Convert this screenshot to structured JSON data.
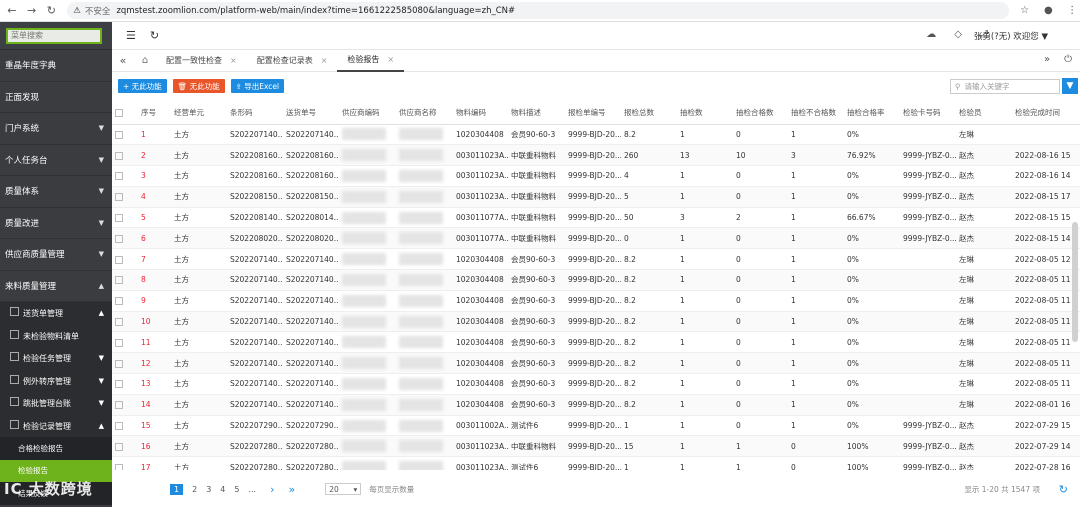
{
  "browser": {
    "back_icon": "arrow-left",
    "forward_icon": "arrow-right",
    "reload_icon": "reload",
    "insecure_label": "不安全",
    "url": "zqmstest.zoomlion.com/platform-web/main/index?time=1661222585080&language=zh_CN#"
  },
  "sidebar": {
    "search_placeholder": "菜单搜索",
    "items": [
      {
        "label": "重晶年度字典",
        "arrow": ""
      },
      {
        "label": "正面发现",
        "arrow": ""
      },
      {
        "label": "门户系统",
        "arrow": "▼"
      },
      {
        "label": "个人任务台",
        "arrow": "▼"
      },
      {
        "label": "质量体系",
        "arrow": "▼"
      },
      {
        "label": "质量改进",
        "arrow": "▼"
      },
      {
        "label": "供应商质量管理",
        "arrow": "▼"
      },
      {
        "label": "来料质量管理",
        "arrow": "▲"
      }
    ],
    "subitems": [
      {
        "label": "送货单管理",
        "arrow": "▲"
      },
      {
        "label": "未检验物料清单",
        "arrow": ""
      },
      {
        "label": "检验任务管理",
        "arrow": "▼"
      },
      {
        "label": "例外转序管理",
        "arrow": "▼"
      },
      {
        "label": "跳批管理台账",
        "arrow": "▼"
      },
      {
        "label": "检验记录管理",
        "arrow": "▲"
      }
    ],
    "leaf_items": [
      "合格检验报告",
      "检验报告",
      "结果反馈"
    ],
    "watermark": "IC 大数跨境"
  },
  "topbar": {
    "user": "张勇(?无) 欢迎您 ▼"
  },
  "tabs": [
    {
      "label": "配置一致性检查"
    },
    {
      "label": "配置检查记录表"
    },
    {
      "label": "检验报告"
    }
  ],
  "toolbar": {
    "btn1": "+ 无此功能",
    "btn2": "无此功能",
    "btn3": "导出Excel",
    "search_placeholder": "请输入关键字"
  },
  "table": {
    "columns": [
      "序号",
      "经营单元",
      "条形码",
      "送货单号",
      "供应商编码",
      "供应商名称",
      "物料编码",
      "物料描述",
      "报检单编号",
      "报检总数",
      "抽检数",
      "抽检合格数",
      "抽检不合格数",
      "抽检合格率",
      "检验卡号码",
      "检验员",
      "检验完成时间"
    ],
    "rows": [
      [
        "1",
        "土方",
        "S202207140...",
        "S202207140...",
        "",
        "",
        "1020304408",
        "会员90-60-3",
        "9999-BJD-20...",
        "8.2",
        "1",
        "0",
        "1",
        "0%",
        "",
        "左琳",
        ""
      ],
      [
        "2",
        "土方",
        "S202208160...",
        "S202208160...",
        "",
        "",
        "003011023A...",
        "中联重科物料",
        "9999-BJD-20...",
        "260",
        "13",
        "10",
        "3",
        "76.92%",
        "9999-JYBZ-0...",
        "赵杰",
        "2022-08-16 15"
      ],
      [
        "3",
        "土方",
        "S202208160...",
        "S202208160...",
        "",
        "",
        "003011023A...",
        "中联重科物料",
        "9999-BJD-20...",
        "4",
        "1",
        "0",
        "1",
        "0%",
        "9999-JYBZ-0...",
        "赵杰",
        "2022-08-16 14"
      ],
      [
        "4",
        "土方",
        "S202208150...",
        "S202208150...",
        "",
        "",
        "003011023A...",
        "中联重科物料",
        "9999-BJD-20...",
        "5",
        "1",
        "0",
        "1",
        "0%",
        "9999-JYBZ-0...",
        "赵杰",
        "2022-08-15 17"
      ],
      [
        "5",
        "土方",
        "S202208140...",
        "S202208014...",
        "",
        "",
        "003011077A...",
        "中联重科物料",
        "9999-BJD-20...",
        "50",
        "3",
        "2",
        "1",
        "66.67%",
        "9999-JYBZ-0...",
        "赵杰",
        "2022-08-15 15"
      ],
      [
        "6",
        "土方",
        "S202208020...",
        "S202208020...",
        "",
        "",
        "003011077A...",
        "中联重科物料",
        "9999-BJD-20...",
        "0",
        "1",
        "0",
        "1",
        "0%",
        "9999-JYBZ-0...",
        "赵杰",
        "2022-08-15 14"
      ],
      [
        "7",
        "土方",
        "S202207140...",
        "S202207140...",
        "",
        "",
        "1020304408",
        "会员90-60-3",
        "9999-BJD-20...",
        "8.2",
        "1",
        "0",
        "1",
        "0%",
        "",
        "左琳",
        "2022-08-05 12"
      ],
      [
        "8",
        "土方",
        "S202207140...",
        "S202207140...",
        "",
        "",
        "1020304408",
        "会员90-60-3",
        "9999-BJD-20...",
        "8.2",
        "1",
        "0",
        "1",
        "0%",
        "",
        "左琳",
        "2022-08-05 11"
      ],
      [
        "9",
        "土方",
        "S202207140...",
        "S202207140...",
        "",
        "",
        "1020304408",
        "会员90-60-3",
        "9999-BJD-20...",
        "8.2",
        "1",
        "0",
        "1",
        "0%",
        "",
        "左琳",
        "2022-08-05 11"
      ],
      [
        "10",
        "土方",
        "S202207140...",
        "S202207140...",
        "",
        "",
        "1020304408",
        "会员90-60-3",
        "9999-BJD-20...",
        "8.2",
        "1",
        "0",
        "1",
        "0%",
        "",
        "左琳",
        "2022-08-05 11"
      ],
      [
        "11",
        "土方",
        "S202207140...",
        "S202207140...",
        "",
        "",
        "1020304408",
        "会员90-60-3",
        "9999-BJD-20...",
        "8.2",
        "1",
        "0",
        "1",
        "0%",
        "",
        "左琳",
        "2022-08-05 11"
      ],
      [
        "12",
        "土方",
        "S202207140...",
        "S202207140...",
        "",
        "",
        "1020304408",
        "会员90-60-3",
        "9999-BJD-20...",
        "8.2",
        "1",
        "0",
        "1",
        "0%",
        "",
        "左琳",
        "2022-08-05 11"
      ],
      [
        "13",
        "土方",
        "S202207140...",
        "S202207140...",
        "",
        "",
        "1020304408",
        "会员90-60-3",
        "9999-BJD-20...",
        "8.2",
        "1",
        "0",
        "1",
        "0%",
        "",
        "左琳",
        "2022-08-05 11"
      ],
      [
        "14",
        "土方",
        "S202207140...",
        "S202207140...",
        "",
        "",
        "1020304408",
        "会员90-60-3",
        "9999-BJD-20...",
        "8.2",
        "1",
        "0",
        "1",
        "0%",
        "",
        "左琳",
        "2022-08-01 16"
      ],
      [
        "15",
        "土方",
        "S202207290...",
        "S202207290...",
        "",
        "",
        "003011002A...",
        "测试件6",
        "9999-BJD-20...",
        "1",
        "1",
        "0",
        "1",
        "0%",
        "9999-JYBZ-0...",
        "赵杰",
        "2022-07-29 15"
      ],
      [
        "16",
        "土方",
        "S202207280...",
        "S202207280...",
        "",
        "",
        "003011023A...",
        "中联重科物料",
        "9999-BJD-20...",
        "15",
        "1",
        "1",
        "0",
        "100%",
        "9999-JYBZ-0...",
        "赵杰",
        "2022-07-29 14"
      ],
      [
        "17",
        "土方",
        "S202207280...",
        "S202207280...",
        "",
        "",
        "003011023A...",
        "测试件6",
        "9999-BJD-20...",
        "1",
        "1",
        "1",
        "0",
        "100%",
        "9999-JYBZ-0...",
        "赵杰",
        "2022-07-28 16"
      ]
    ]
  },
  "pager": {
    "pages": [
      "1",
      "2",
      "3",
      "4",
      "5",
      "..."
    ],
    "prev": "‹",
    "next": "›",
    "last": "»",
    "page_size": "20",
    "page_size_label": "每页显示数量",
    "total": "显示 1-20 共 1547 项"
  }
}
